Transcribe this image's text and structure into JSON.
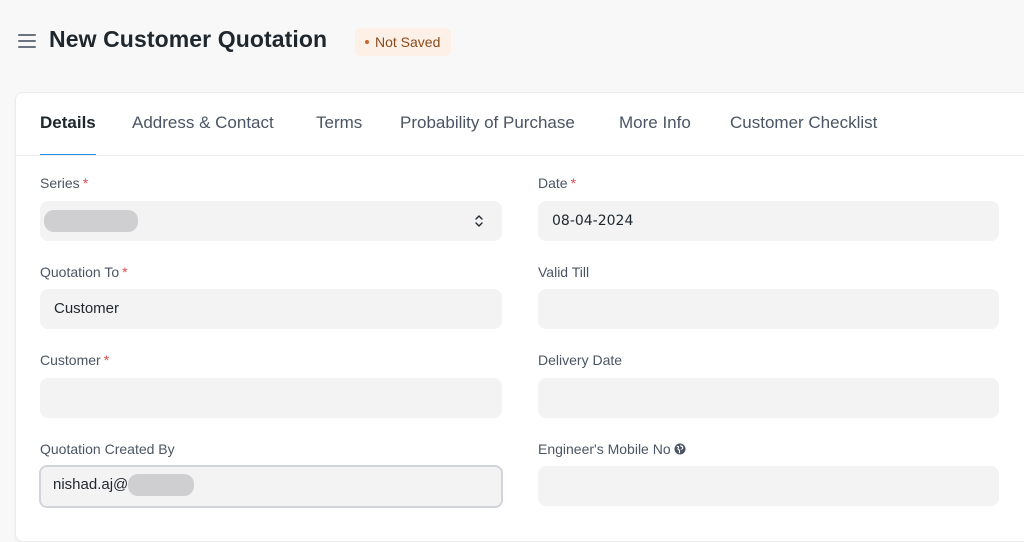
{
  "header": {
    "menu_icon": "hamburger-menu-icon",
    "title": "New Customer Quotation",
    "status": "Not Saved",
    "status_color": "#c7662a"
  },
  "tabs": [
    {
      "label": "Details",
      "active": true
    },
    {
      "label": "Address & Contact"
    },
    {
      "label": "Terms"
    },
    {
      "label": "Probability of Purchase"
    },
    {
      "label": "More Info"
    },
    {
      "label": "Customer Checklist"
    }
  ],
  "form": {
    "series": {
      "label": "Series",
      "required": "*",
      "value": ""
    },
    "date": {
      "label": "Date",
      "required": "*",
      "value": "08-04-2024"
    },
    "quotation_to": {
      "label": "Quotation To",
      "required": "*",
      "value": "Customer"
    },
    "valid_till": {
      "label": "Valid Till",
      "value": ""
    },
    "customer": {
      "label": "Customer",
      "required": "*",
      "value": ""
    },
    "delivery_date": {
      "label": "Delivery Date",
      "value": ""
    },
    "created_by": {
      "label": "Quotation Created By",
      "value": "nishad.aj@"
    },
    "engineer_mobile": {
      "label": "Engineer's Mobile No",
      "icon": "globe-icon",
      "value": ""
    }
  },
  "colors": {
    "accent": "#2490ef",
    "required": "#e24c4c",
    "field_bg": "#f3f3f4"
  }
}
